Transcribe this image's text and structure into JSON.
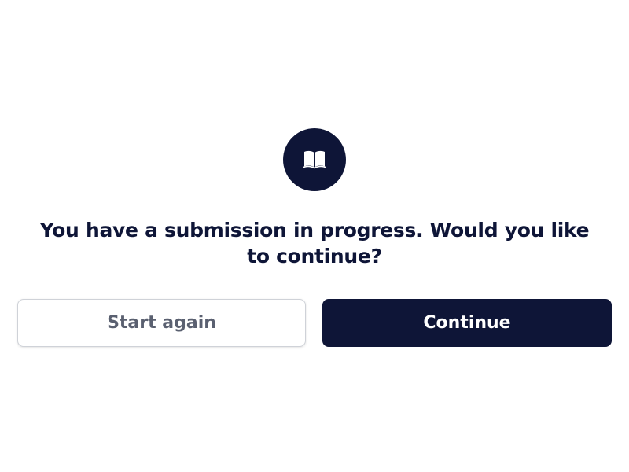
{
  "dialog": {
    "message": "You have a submission in progress. Would you like to continue?",
    "icon": "book-icon",
    "start_again_label": "Start again",
    "continue_label": "Continue"
  },
  "colors": {
    "primary": "#0e1537",
    "secondary_text": "#5a6070",
    "secondary_border": "#cfd2d8",
    "background": "#ffffff"
  }
}
